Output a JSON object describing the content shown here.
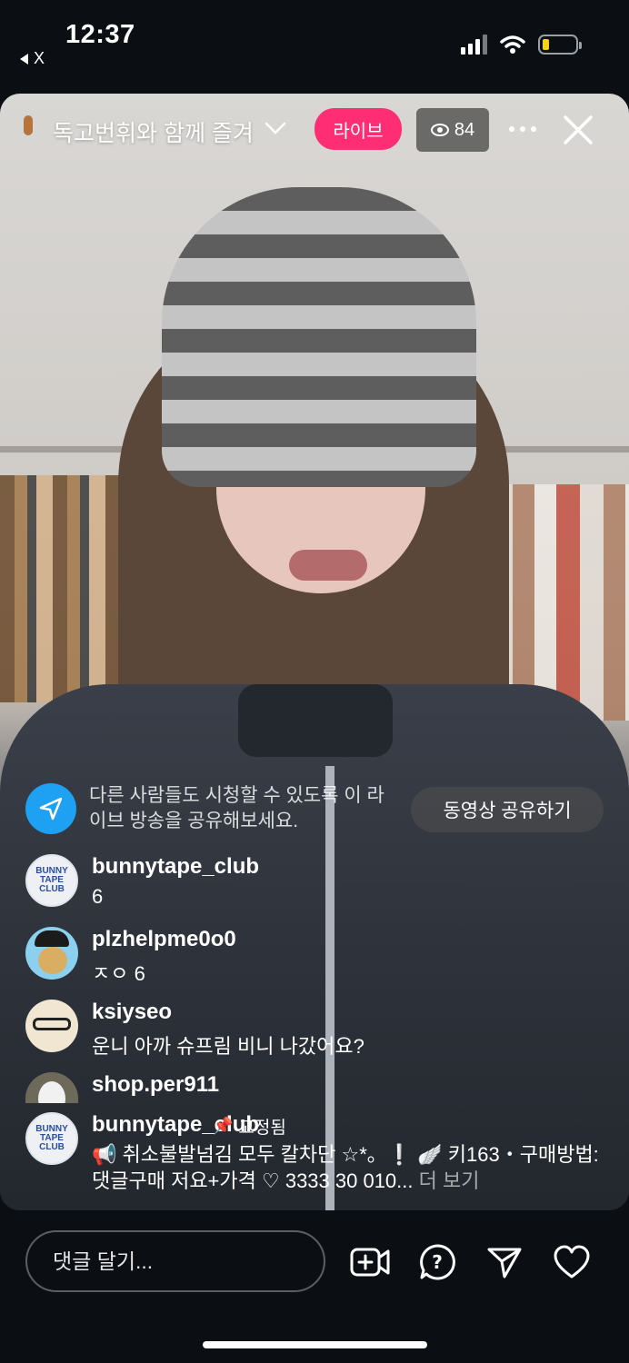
{
  "status_bar": {
    "time": "12:37",
    "back_label": "X",
    "battery_color": "#f5d50b"
  },
  "header": {
    "title": "독고번휘와 함께 즐겨",
    "live_label": "라이브",
    "viewer_count": "84",
    "live_color": "#ff2d73"
  },
  "share_prompt": {
    "text": "다른 사람들도 시청할 수 있도록 이 라이브 방송을 공유해보세요.",
    "button": "동영상 공유하기"
  },
  "comments": [
    {
      "user": "bunnytape_club",
      "message": "6",
      "avatar": "bunny-logo"
    },
    {
      "user": "plzhelpme0o0",
      "message": "ㅈㅇ 6",
      "avatar": "pirate-hamster"
    },
    {
      "user": "ksiyseo",
      "message": "운니 아까 슈프림 비니 나갔어요?",
      "avatar": "kitty-glasses"
    },
    {
      "user": "shop.per911",
      "message": "",
      "avatar": "cat-photo"
    }
  ],
  "pinned_comment": {
    "user": "bunnytape_club",
    "pinned_label": "고정됨",
    "message": "📢 취소불발넘김 모두 칼차단 ☆*。❕ 🪽 키163・구매방법: 댓글구매 저요+가격 ♡ 3333 30 010...",
    "more_label": "더 보기"
  },
  "bottom_bar": {
    "comment_placeholder": "댓글 달기..."
  },
  "icons": [
    "back-icon",
    "signal-icon",
    "wifi-icon",
    "battery-icon",
    "chevron-down-icon",
    "eye-icon",
    "more-icon",
    "close-icon",
    "send-icon",
    "pin-icon",
    "add-video-icon",
    "question-icon",
    "direct-send-icon",
    "heart-icon"
  ]
}
